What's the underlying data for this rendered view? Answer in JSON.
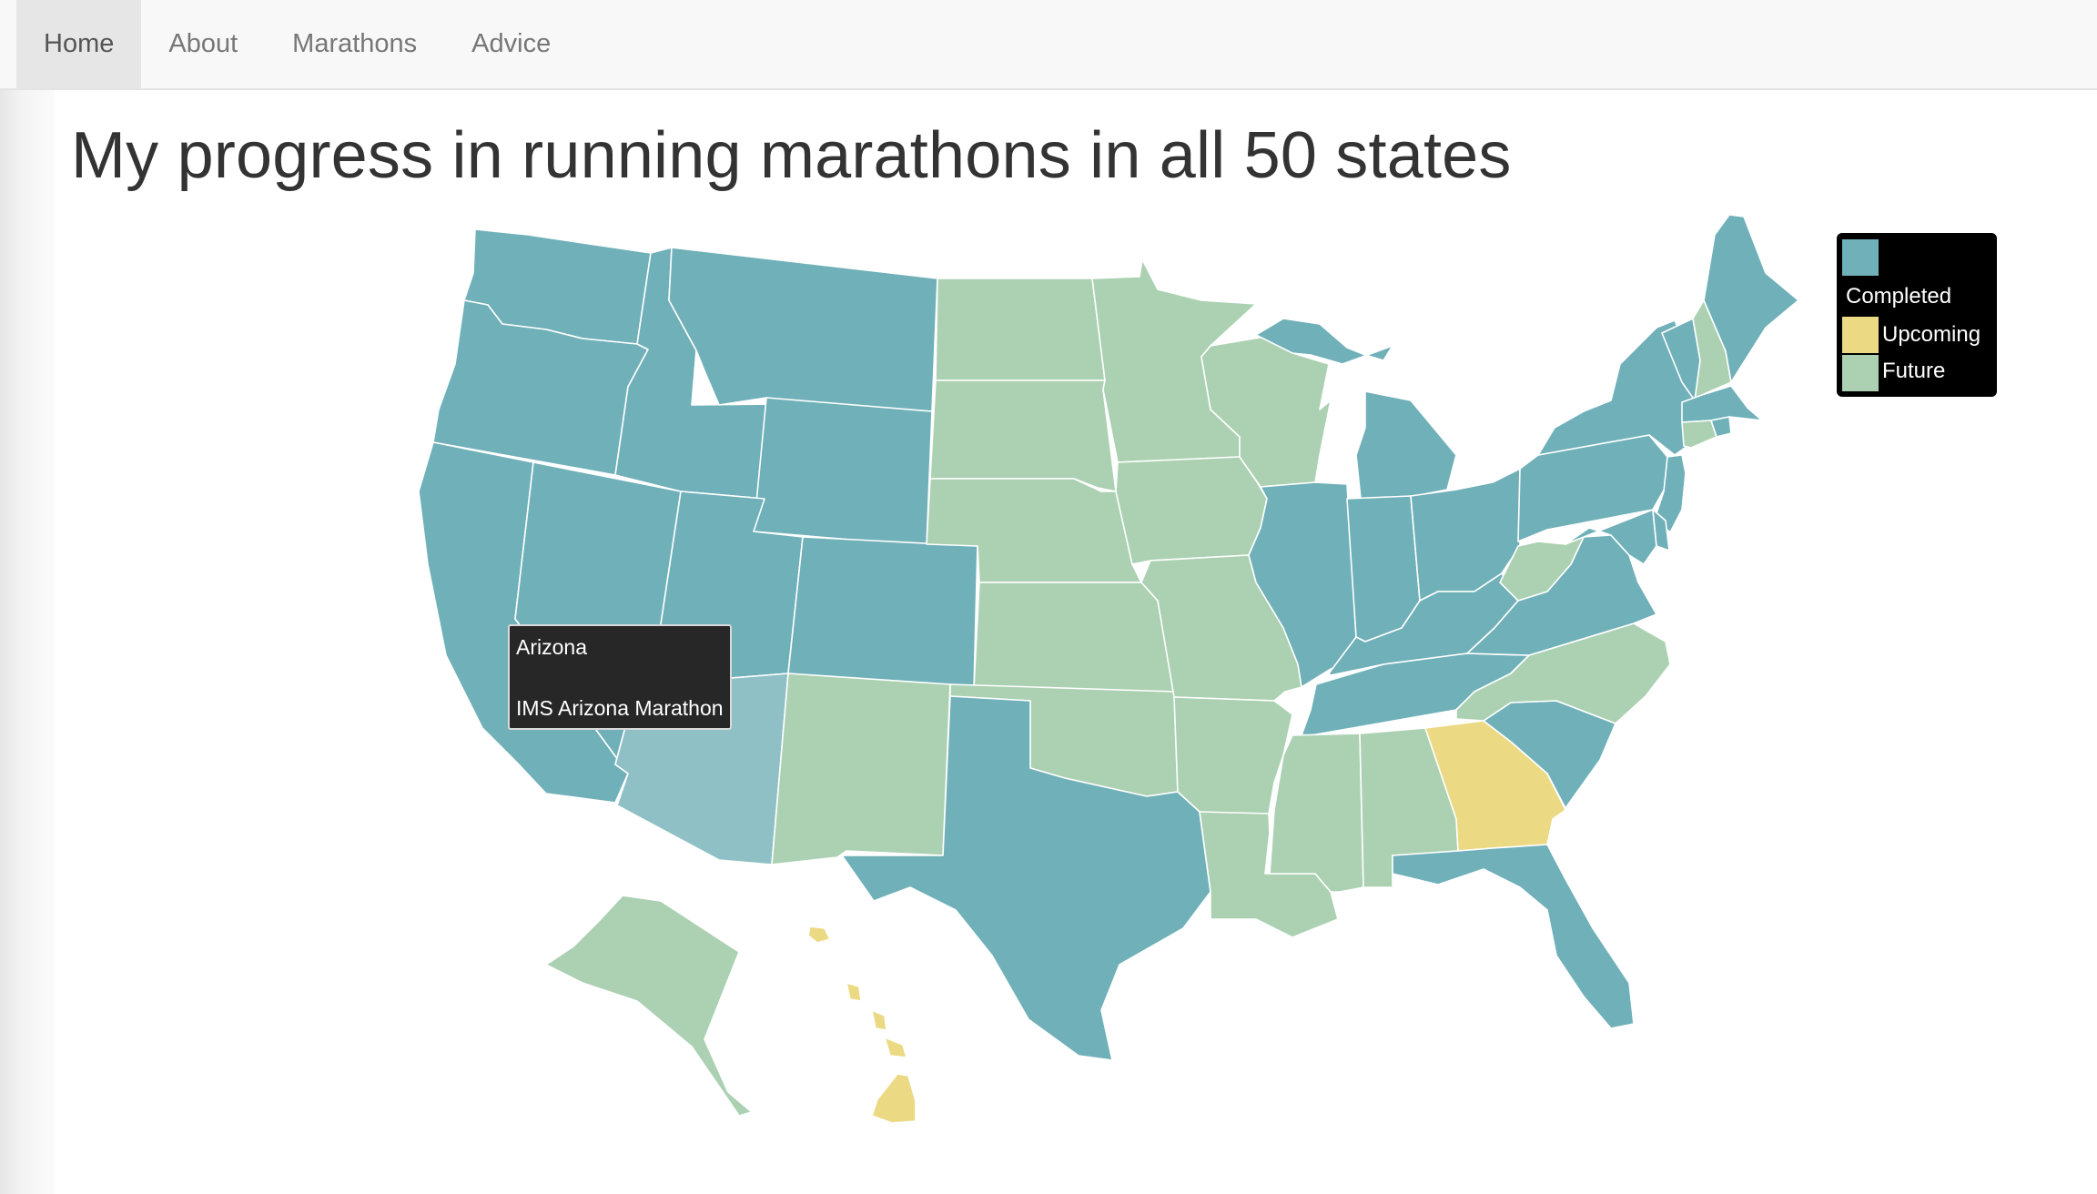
{
  "nav": {
    "items": [
      {
        "label": "Home",
        "active": true
      },
      {
        "label": "About",
        "active": false
      },
      {
        "label": "Marathons",
        "active": false
      },
      {
        "label": "Advice",
        "active": false
      }
    ]
  },
  "page": {
    "title": "My progress in running marathons in all 50 states"
  },
  "map": {
    "colors": {
      "completed": "#70b0b9",
      "upcoming": "#ebd984",
      "future": "#abd1b2",
      "hover": "#8fc0c6",
      "border": "#ffffff"
    },
    "status_by_state": {
      "Washington": "completed",
      "Oregon": "completed",
      "California": "completed",
      "Nevada": "completed",
      "Idaho": "completed",
      "Montana": "completed",
      "Wyoming": "completed",
      "Utah": "completed",
      "Colorado": "completed",
      "Arizona": "completed",
      "Texas": "completed",
      "Illinois": "completed",
      "Michigan": "completed",
      "Indiana": "completed",
      "Ohio": "completed",
      "Kentucky": "completed",
      "Tennessee": "completed",
      "Florida": "completed",
      "South Carolina": "completed",
      "Virginia": "completed",
      "Maryland": "completed",
      "Delaware": "completed",
      "New Jersey": "completed",
      "Pennsylvania": "completed",
      "New York": "completed",
      "Vermont": "completed",
      "Massachusetts": "completed",
      "Maine": "completed",
      "Rhode Island": "completed",
      "Georgia": "upcoming",
      "Hawaii": "upcoming",
      "North Dakota": "future",
      "South Dakota": "future",
      "Nebraska": "future",
      "Kansas": "future",
      "Oklahoma": "future",
      "New Mexico": "future",
      "Minnesota": "future",
      "Iowa": "future",
      "Missouri": "future",
      "Arkansas": "future",
      "Louisiana": "future",
      "Wisconsin": "future",
      "Mississippi": "future",
      "Alabama": "future",
      "North Carolina": "future",
      "West Virginia": "future",
      "New Hampshire": "future",
      "Connecticut": "future",
      "Alaska": "future"
    },
    "hovered_state": "Arizona"
  },
  "tooltip": {
    "state": "Arizona",
    "event": "IMS Arizona Marathon"
  },
  "legend": {
    "title": "",
    "items": [
      {
        "key": "completed",
        "label": "Completed"
      },
      {
        "key": "upcoming",
        "label": "Upcoming"
      },
      {
        "key": "future",
        "label": "Future"
      }
    ]
  }
}
